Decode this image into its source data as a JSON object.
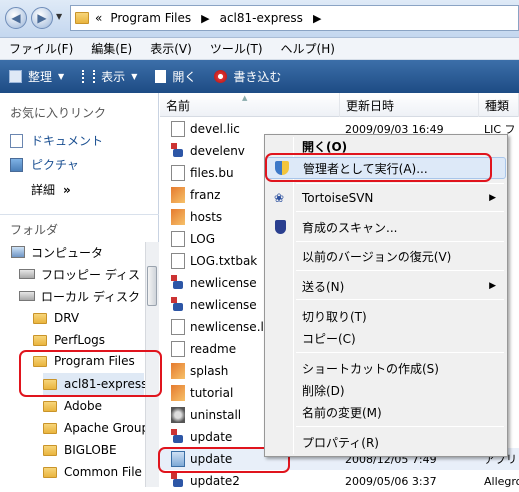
{
  "address": {
    "prefix": "«",
    "crumbs": [
      "Program Files",
      "acl81-express"
    ]
  },
  "menubar": [
    "ファイル(F)",
    "編集(E)",
    "表示(V)",
    "ツール(T)",
    "ヘルプ(H)"
  ],
  "toolbar": {
    "organize": "整理",
    "view": "表示",
    "open": "開く",
    "burn": "書き込む"
  },
  "favorites": {
    "title": "お気に入りリンク",
    "items": [
      "ドキュメント",
      "ピクチャ"
    ],
    "more": "詳細"
  },
  "folders": {
    "title": "フォルダ",
    "tree": [
      "コンピュータ",
      "フロッピー ディス",
      "ローカル ディスク",
      "DRV",
      "PerfLogs",
      "Program Files",
      "acl81-express",
      "Adobe",
      "Apache Group",
      "BIGLOBE",
      "Common File"
    ]
  },
  "columns": {
    "name": "名前",
    "date": "更新日時",
    "type": "種類"
  },
  "files": [
    {
      "name": "devel.lic",
      "date": "2009/09/03 16:49",
      "type": "LIC フ"
    },
    {
      "name": "develenv",
      "date": "",
      "type": "gr"
    },
    {
      "name": "files.bu",
      "date": "",
      "type": ""
    },
    {
      "name": "franz",
      "date": "",
      "type": "gr"
    },
    {
      "name": "hosts",
      "date": "",
      "type": ""
    },
    {
      "name": "LOG",
      "date": "",
      "type": ""
    },
    {
      "name": "LOG.txtbak",
      "date": "",
      "type": "TE"
    },
    {
      "name": "newlicense",
      "date": "",
      "type": "gr"
    },
    {
      "name": "newlicense",
      "date": "",
      "type": "gr"
    },
    {
      "name": "newlicense.lic",
      "date": "",
      "type": "フ"
    },
    {
      "name": "readme",
      "date": "",
      "type": ""
    },
    {
      "name": "splash",
      "date": "",
      "type": "gr"
    },
    {
      "name": "tutorial",
      "date": "",
      "type": "gr"
    },
    {
      "name": "uninstall",
      "date": "",
      "type": "ケー"
    },
    {
      "name": "update",
      "date": "",
      "type": "gr"
    },
    {
      "name": "update",
      "date": "2008/12/05 7:49",
      "type": "アプリ"
    },
    {
      "name": "update2",
      "date": "2009/05/06 3:37",
      "type": "Allegro"
    }
  ],
  "context_menu": {
    "open": "開く(O)",
    "run_as_admin": "管理者として実行(A)...",
    "tortoise": "TortoiseSVN",
    "scan": "育成のスキャン...",
    "restore": "以前のバージョンの復元(V)",
    "send_to": "送る(N)",
    "cut": "切り取り(T)",
    "copy": "コピー(C)",
    "shortcut": "ショートカットの作成(S)",
    "delete": "削除(D)",
    "rename": "名前の変更(M)",
    "properties": "プロパティ(R)"
  },
  "colors": {
    "highlight": "#e0141d",
    "toolbar": "#1d4b84",
    "link": "#1a4f91"
  }
}
